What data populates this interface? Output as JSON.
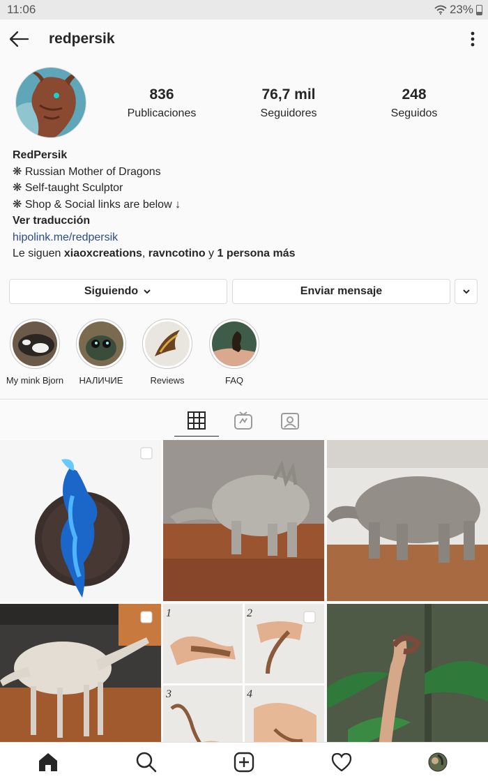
{
  "status_bar": {
    "time": "11:06",
    "battery": "23%"
  },
  "header": {
    "username": "redpersik"
  },
  "stats": [
    {
      "value": "836",
      "label": "Publicaciones"
    },
    {
      "value": "76,7 mil",
      "label": "Seguidores"
    },
    {
      "value": "248",
      "label": "Seguidos"
    }
  ],
  "bio": {
    "name": "RedPersik",
    "line1": "❋ Russian Mother of Dragons",
    "line2": "❋ Self-taught Sculptor",
    "line3": "❋ Shop & Social links are below ↓",
    "translate": "Ver traducción",
    "link": "hipolink.me/redpersik",
    "followed_prefix": "Le siguen ",
    "followed_user1": "xiaoxcreations",
    "followed_sep": ", ",
    "followed_user2": "ravncotino",
    "followed_and": " y ",
    "followed_more": "1 persona más"
  },
  "buttons": {
    "following": "Siguiendo",
    "message": "Enviar mensaje"
  },
  "highlights": [
    {
      "label": "My mink Bjorn"
    },
    {
      "label": "НАЛИЧИЕ"
    },
    {
      "label": "Reviews"
    },
    {
      "label": "FAQ"
    }
  ],
  "tabs": [
    {
      "icon": "grid-icon",
      "active": true
    },
    {
      "icon": "igtv-icon",
      "active": false
    },
    {
      "icon": "tagged-icon",
      "active": false
    }
  ],
  "grid": [
    {
      "subject": "blue dragon pendant"
    },
    {
      "subject": "clay dragon sculpture"
    },
    {
      "subject": "clay creature sculpture"
    },
    {
      "subject": "white clay armature"
    },
    {
      "subject": "clay tail steps 1-4"
    },
    {
      "subject": "dragon figure on fern"
    }
  ],
  "nav": [
    "home-icon",
    "search-icon",
    "new-post-icon",
    "activity-icon",
    "profile-avatar"
  ],
  "colors": {
    "link": "#2a4d8a",
    "text": "#262626",
    "border": "#dbdbdb"
  }
}
